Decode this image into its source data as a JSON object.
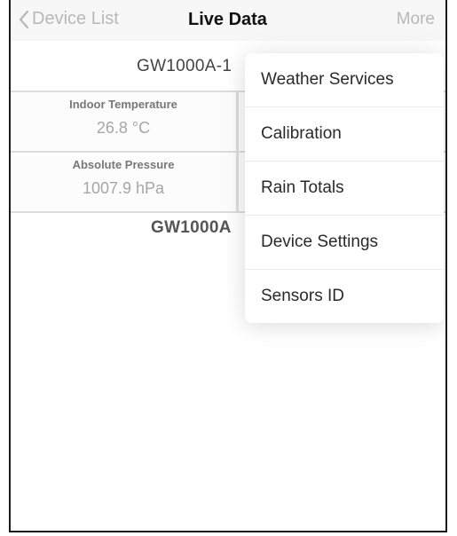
{
  "nav": {
    "back_label": "Device List",
    "title": "Live Data",
    "more_label": "More"
  },
  "devices": [
    {
      "name": "GW1000A-1",
      "tiles": [
        {
          "label": "Indoor Temperature",
          "value": "26.8 °C"
        },
        {
          "label": "Absolute Pressure",
          "value": "1007.9 hPa"
        }
      ]
    },
    {
      "name": "GW1000A"
    }
  ],
  "menu": {
    "items": [
      {
        "label": "Weather Services"
      },
      {
        "label": "Calibration"
      },
      {
        "label": "Rain Totals"
      },
      {
        "label": "Device Settings"
      },
      {
        "label": "Sensors ID"
      }
    ]
  }
}
